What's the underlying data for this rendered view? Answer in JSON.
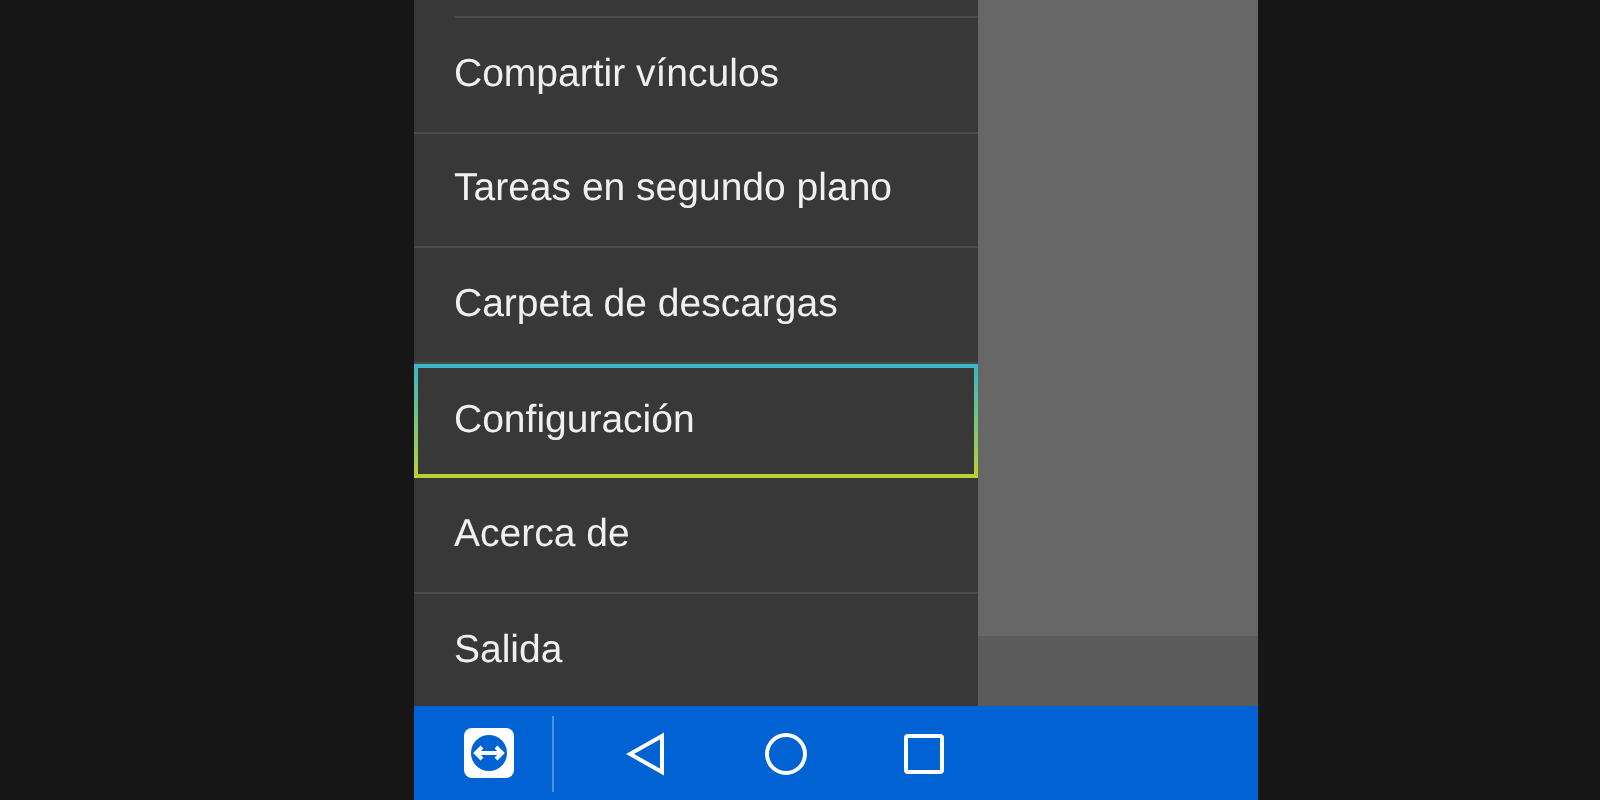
{
  "menu": {
    "items": [
      {
        "label": "Compartir vínculos",
        "highlighted": false
      },
      {
        "label": "Tareas en segundo plano",
        "highlighted": false
      },
      {
        "label": "Carpeta de descargas",
        "highlighted": false
      },
      {
        "label": "Configuración",
        "highlighted": true
      },
      {
        "label": "Acerca de",
        "highlighted": false
      },
      {
        "label": "Salida",
        "highlighted": false
      }
    ]
  }
}
